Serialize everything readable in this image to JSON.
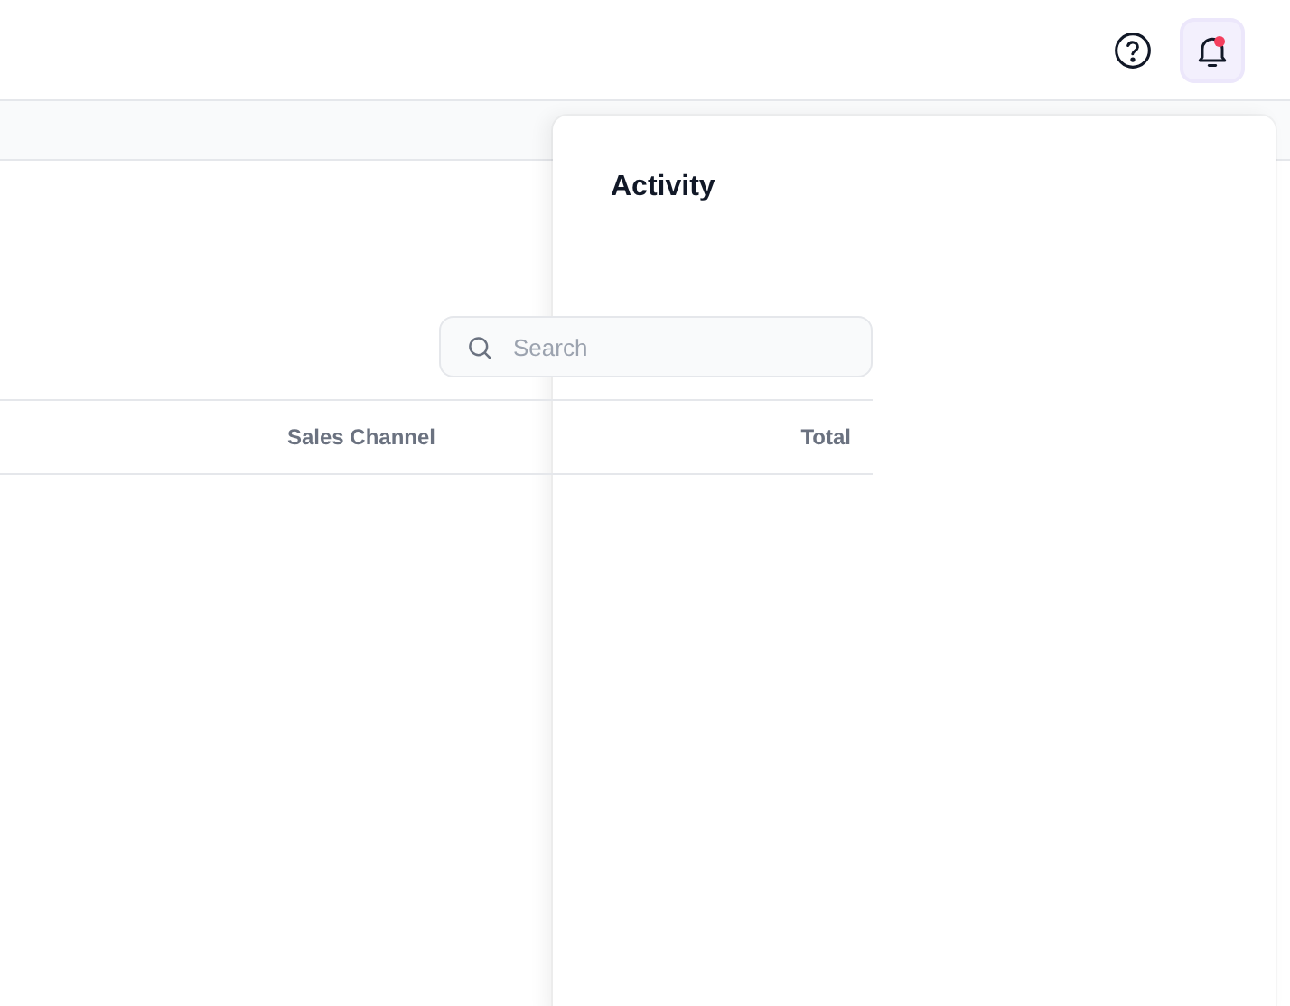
{
  "topbar": {
    "buttons": [
      {
        "kind": "help",
        "selected": false,
        "unread": false
      },
      {
        "kind": "notifications",
        "selected": true,
        "unread": true
      }
    ]
  },
  "search": {
    "placeholder": "Search"
  },
  "table": {
    "columns": [
      "Sales Channel",
      "Total"
    ]
  },
  "activity_panel": {
    "title": "Activity"
  }
}
